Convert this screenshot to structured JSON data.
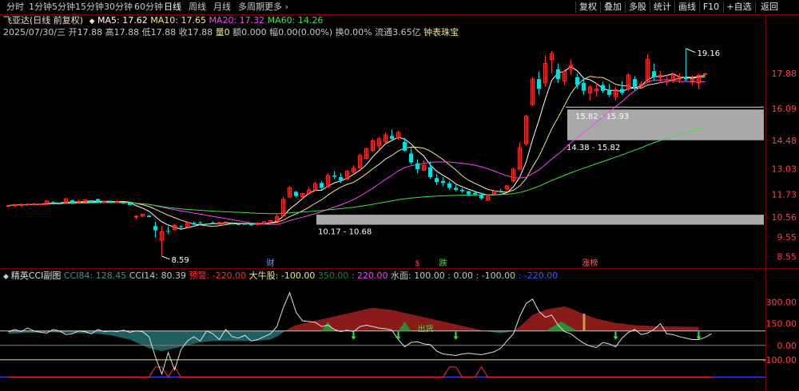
{
  "toolbar": {
    "period_tabs": [
      "分时",
      "1分钟",
      "5分钟",
      "15分钟",
      "30分钟",
      "60分钟",
      "日线",
      "周线",
      "月线",
      "多周期",
      "更多"
    ],
    "active_period": "日线",
    "right_buttons": [
      "复权",
      "叠加",
      "多股",
      "统计",
      "画线",
      "F10",
      "+自选",
      "返回"
    ]
  },
  "header": {
    "title": "飞亚达(日线 前复权)",
    "ma": [
      {
        "label": "MA5: 17.62",
        "color": "#ffffff"
      },
      {
        "label": "MA10: 17.65",
        "color": "#f0e68c"
      },
      {
        "label": "MA20: 17.32",
        "color": "#ff40ff"
      },
      {
        "label": "MA60: 14.26",
        "color": "#40e040"
      }
    ],
    "quote": [
      {
        "text": "2025/07/30/三",
        "color": "#c8c8c8"
      },
      {
        "text": "开17.88",
        "color": "#c8c8c8"
      },
      {
        "text": "高17.88",
        "color": "#c8c8c8"
      },
      {
        "text": "低17.88",
        "color": "#c8c8c8"
      },
      {
        "text": "收17.88",
        "color": "#c8c8c8"
      },
      {
        "text": "量0",
        "color": "#f0e68c"
      },
      {
        "text": "额0.000",
        "color": "#c8c8c8"
      },
      {
        "text": "幅0.00(0.00%)",
        "color": "#c8c8c8"
      },
      {
        "text": "换0.00%",
        "color": "#c8c8c8"
      },
      {
        "text": "流通3.65亿",
        "color": "#c8c8c8"
      },
      {
        "text": "钟表珠宝",
        "color": "#f0e68c"
      }
    ]
  },
  "chart_data": [
    {
      "type": "candlestick",
      "title": "飞亚达(日线 前复权)",
      "ylim": [
        8.2,
        19.6
      ],
      "y_ticks": [
        8.55,
        9.55,
        10.56,
        11.73,
        13.03,
        14.48,
        16.09,
        17.88
      ],
      "candles": [
        [
          11.15,
          11.15,
          11.05,
          11.15
        ],
        [
          11.14,
          11.23,
          11.09,
          11.2
        ],
        [
          11.15,
          11.25,
          11.1,
          11.21
        ],
        [
          11.2,
          11.25,
          11.12,
          11.22
        ],
        [
          11.2,
          11.28,
          11.16,
          11.24
        ],
        [
          11.2,
          11.26,
          11.17,
          11.23
        ],
        [
          11.2,
          11.42,
          11.18,
          11.38
        ],
        [
          11.32,
          11.37,
          11.2,
          11.28
        ],
        [
          11.28,
          11.3,
          11.2,
          11.23
        ],
        [
          11.29,
          11.53,
          11.23,
          11.49
        ],
        [
          11.42,
          11.44,
          11.23,
          11.28
        ],
        [
          11.3,
          11.45,
          11.26,
          11.36
        ],
        [
          11.34,
          11.46,
          11.34,
          11.44
        ],
        [
          11.38,
          11.42,
          11.3,
          11.35
        ],
        [
          11.48,
          11.5,
          11.32,
          11.34
        ],
        [
          11.34,
          11.4,
          11.29,
          11.35
        ],
        [
          11.36,
          11.42,
          11.27,
          11.32
        ],
        [
          11.3,
          11.42,
          11.27,
          11.35
        ],
        [
          11.32,
          11.34,
          11.25,
          11.26
        ],
        [
          11.28,
          11.31,
          11.15,
          11.18
        ],
        [
          10.59,
          10.67,
          10.45,
          10.6
        ],
        [
          10.62,
          10.72,
          10.56,
          10.7
        ],
        [
          10.63,
          10.67,
          10.54,
          10.56
        ],
        [
          10.1,
          10.32,
          9.53,
          9.89
        ],
        [
          9.38,
          10.1,
          8.57,
          9.81
        ],
        [
          9.85,
          10.1,
          9.7,
          9.82
        ],
        [
          9.92,
          10.18,
          9.87,
          10.13
        ],
        [
          10.09,
          10.14,
          9.95,
          10.05
        ],
        [
          10.05,
          10.28,
          10.05,
          10.28
        ],
        [
          10.26,
          10.32,
          10.15,
          10.18
        ],
        [
          10.28,
          10.35,
          10.17,
          10.24
        ],
        [
          10.23,
          10.25,
          10.2,
          10.22
        ],
        [
          10.28,
          10.34,
          10.2,
          10.22
        ],
        [
          10.2,
          10.32,
          10.18,
          10.28
        ],
        [
          10.3,
          10.34,
          10.26,
          10.31
        ],
        [
          10.26,
          10.32,
          10.2,
          10.22
        ],
        [
          10.2,
          10.25,
          10.14,
          10.18
        ],
        [
          10.21,
          10.22,
          10.18,
          10.2
        ],
        [
          10.22,
          10.24,
          10.12,
          10.14
        ],
        [
          10.18,
          10.3,
          10.12,
          10.25
        ],
        [
          10.24,
          10.36,
          10.17,
          10.32
        ],
        [
          10.32,
          10.42,
          10.28,
          10.38
        ],
        [
          10.38,
          10.7,
          10.3,
          10.6
        ],
        [
          10.62,
          11.6,
          10.58,
          11.46
        ],
        [
          11.58,
          12.15,
          11.55,
          12.05
        ],
        [
          11.85,
          11.9,
          11.55,
          11.63
        ],
        [
          11.6,
          11.78,
          11.45,
          11.76
        ],
        [
          11.75,
          12.1,
          11.7,
          11.92
        ],
        [
          11.95,
          12.37,
          11.9,
          12.26
        ],
        [
          12.3,
          12.4,
          11.95,
          12.05
        ],
        [
          12.1,
          12.8,
          12.08,
          12.68
        ],
        [
          12.68,
          12.9,
          12.5,
          12.62
        ],
        [
          12.6,
          12.8,
          12.3,
          12.44
        ],
        [
          12.5,
          12.96,
          12.45,
          12.9
        ],
        [
          12.85,
          13.21,
          12.8,
          13.06
        ],
        [
          13.06,
          13.8,
          13.04,
          13.7
        ],
        [
          13.55,
          14.1,
          13.5,
          14.05
        ],
        [
          13.95,
          14.55,
          13.9,
          14.45
        ],
        [
          14.2,
          14.65,
          14.02,
          14.55
        ],
        [
          14.4,
          14.88,
          14.3,
          14.75
        ],
        [
          14.7,
          15.03,
          14.45,
          14.55
        ],
        [
          14.6,
          14.97,
          14.5,
          14.88
        ],
        [
          14.4,
          14.6,
          13.9,
          13.95
        ],
        [
          13.8,
          14.1,
          13.25,
          13.35
        ],
        [
          13.3,
          13.5,
          12.8,
          13.0
        ],
        [
          12.95,
          13.45,
          12.9,
          13.2
        ],
        [
          13.1,
          13.4,
          12.5,
          12.6
        ],
        [
          12.55,
          12.75,
          12.2,
          12.35
        ],
        [
          12.4,
          12.6,
          12.15,
          12.3
        ],
        [
          12.28,
          12.4,
          11.95,
          12.05
        ],
        [
          12.05,
          12.2,
          11.88,
          11.95
        ],
        [
          11.95,
          12.05,
          11.8,
          11.88
        ],
        [
          11.88,
          11.9,
          11.65,
          11.72
        ],
        [
          11.8,
          11.9,
          11.68,
          11.72
        ],
        [
          11.7,
          11.8,
          11.45,
          11.52
        ],
        [
          11.42,
          11.7,
          11.38,
          11.62
        ],
        [
          11.75,
          11.95,
          11.7,
          11.88
        ],
        [
          11.9,
          12.0,
          11.8,
          11.85
        ],
        [
          12.0,
          12.2,
          11.9,
          12.15
        ],
        [
          12.4,
          13.1,
          12.35,
          13.0
        ],
        [
          13.0,
          14.38,
          12.95,
          14.1
        ],
        [
          14.3,
          15.78,
          14.2,
          15.7
        ],
        [
          16.3,
          17.7,
          16.2,
          17.6
        ],
        [
          17.6,
          18.0,
          16.8,
          17.1
        ],
        [
          17.4,
          18.8,
          17.2,
          18.4
        ],
        [
          18.6,
          19.04,
          17.9,
          18.9
        ],
        [
          18.1,
          18.4,
          17.4,
          17.6
        ],
        [
          17.5,
          18.1,
          17.3,
          18.0
        ],
        [
          18.1,
          18.6,
          17.8,
          18.3
        ],
        [
          17.7,
          17.88,
          17.1,
          17.3
        ],
        [
          17.4,
          17.7,
          16.8,
          17.0
        ],
        [
          16.9,
          17.3,
          16.5,
          17.2
        ],
        [
          17.0,
          17.4,
          16.7,
          17.1
        ],
        [
          17.3,
          17.45,
          16.9,
          17.0
        ],
        [
          17.0,
          17.35,
          16.7,
          16.8
        ],
        [
          16.7,
          17.2,
          16.5,
          17.05
        ],
        [
          17.1,
          17.5,
          16.8,
          16.9
        ],
        [
          17.1,
          17.9,
          17.0,
          17.8
        ],
        [
          17.6,
          17.75,
          17.0,
          17.2
        ],
        [
          17.3,
          17.5,
          17.1,
          17.35
        ],
        [
          17.5,
          18.9,
          17.4,
          18.6
        ],
        [
          18.0,
          18.4,
          17.5,
          17.7
        ],
        [
          17.7,
          18.0,
          17.4,
          17.8
        ],
        [
          17.5,
          17.8,
          17.3,
          17.5
        ],
        [
          17.5,
          17.9,
          17.4,
          17.8
        ],
        [
          17.6,
          17.9,
          17.4,
          17.7
        ],
        [
          17.7,
          19.16,
          17.5,
          17.6
        ],
        [
          17.5,
          17.8,
          17.3,
          17.6
        ],
        [
          17.4,
          17.88,
          17.1,
          17.8
        ],
        [
          17.88,
          17.88,
          17.88,
          17.88
        ]
      ],
      "zones": [
        {
          "label": "15.82 - 15.93",
          "low": 14.48,
          "high": 16.05
        },
        {
          "label": "14.38 - 15.82"
        },
        {
          "label": "10.17 - 10.68",
          "low": 10.17,
          "high": 10.68
        }
      ],
      "annotations": [
        {
          "text": "19.16",
          "kind": "high"
        },
        {
          "text": "8.59",
          "kind": "low"
        }
      ],
      "event_marks": [
        {
          "text": "财",
          "color": "#6aa0ff"
        },
        {
          "text": "$",
          "color": "#ff4040"
        },
        {
          "text": "跌",
          "color": "#40e040"
        },
        {
          "text": "涨榜",
          "color": "#ff6060"
        }
      ],
      "series": [
        {
          "name": "MA5",
          "color": "#ffffff"
        },
        {
          "name": "MA10",
          "color": "#f0e68c"
        },
        {
          "name": "MA20",
          "color": "#ff40ff"
        },
        {
          "name": "MA60",
          "color": "#40e040"
        }
      ]
    },
    {
      "type": "line",
      "title": "精英CCI副图",
      "ylim": [
        -250,
        430
      ],
      "y_ticks": [
        300,
        150,
        0,
        -100
      ],
      "y_tick_labels": [
        "300.00",
        "150.00",
        "0.00",
        "-100.00"
      ],
      "labels": [
        {
          "text": "CCI84: 128.45",
          "color": "#5a8a8a"
        },
        {
          "text": "CCI14: 80.39",
          "color": "#c8c8c8"
        },
        {
          "text": "预警: -220.00",
          "color": "#ff3030"
        },
        {
          "text": "大牛股: -100.00",
          "color": "#f0e68c"
        },
        {
          "text": "350.00",
          "color": "#2e7d2e"
        },
        {
          "text": ": 220.00",
          "color": "#ff40ff"
        },
        {
          "text": "水面: 100.00",
          "color": "#c8c8c8"
        },
        {
          "text": ": 0.00",
          "color": "#c8c8c8"
        },
        {
          "text": ": -100.00",
          "color": "#c8c8c8"
        },
        {
          "text": ": -220.00",
          "color": "#5050ff"
        }
      ],
      "overlay_text": "出货",
      "cci14": [
        95,
        110,
        95,
        120,
        100,
        90,
        85,
        110,
        100,
        75,
        80,
        100,
        95,
        80,
        110,
        95,
        100,
        95,
        105,
        90,
        100,
        95,
        60,
        -80,
        -200,
        -50,
        -170,
        -30,
        30,
        60,
        30,
        100,
        80,
        40,
        110,
        60,
        50,
        70,
        30,
        40,
        60,
        80,
        130,
        260,
        365,
        230,
        170,
        165,
        160,
        130,
        140,
        110,
        95,
        105,
        95,
        130,
        140,
        130,
        120,
        115,
        105,
        40,
        -10,
        20,
        25,
        10,
        5,
        -40,
        -60,
        -65,
        -70,
        -60,
        -55,
        -60,
        -65,
        -55,
        -45,
        -20,
        30,
        80,
        200,
        290,
        320,
        235,
        195,
        210,
        140,
        95,
        80,
        45,
        15,
        -5,
        -15,
        20,
        10,
        -10,
        50,
        90,
        110,
        75,
        85,
        110,
        150,
        80,
        75,
        60,
        50,
        40,
        40,
        55,
        80
      ],
      "cci84": [
        80,
        82,
        85,
        87,
        88,
        90,
        92,
        90,
        88,
        86,
        85,
        84,
        83,
        82,
        80,
        75,
        70,
        60,
        50,
        40,
        20,
        0,
        -20,
        -30,
        -40,
        -30,
        -20,
        -10,
        0,
        10,
        20,
        25,
        30,
        30,
        30,
        30,
        30,
        30,
        30,
        32,
        35,
        40,
        60,
        90,
        120,
        140,
        150,
        160,
        170,
        180,
        190,
        200,
        210,
        220,
        230,
        240,
        250,
        260,
        255,
        250,
        245,
        235,
        225,
        215,
        205,
        195,
        185,
        175,
        165,
        155,
        145,
        135,
        125,
        115,
        105,
        95,
        90,
        85,
        90,
        100,
        130,
        170,
        210,
        230,
        245,
        255,
        262,
        270,
        255,
        235,
        215,
        200,
        185,
        175,
        165,
        155,
        150,
        145,
        140,
        138,
        135,
        133,
        132,
        131,
        130,
        130,
        129,
        129,
        128
      ]
    }
  ]
}
